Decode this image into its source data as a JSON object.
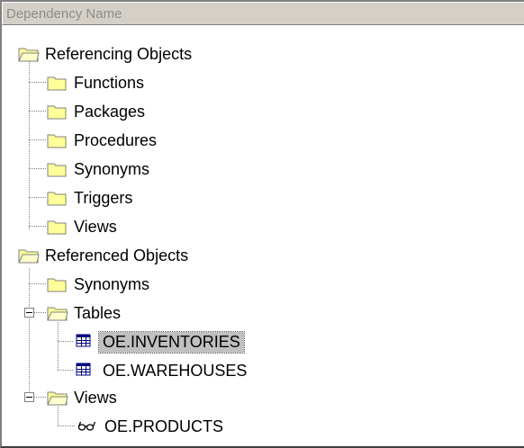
{
  "header": {
    "column_title": "Dependency Name"
  },
  "tree": {
    "referencing": {
      "label": "Referencing Objects",
      "children": [
        "Functions",
        "Packages",
        "Procedures",
        "Synonyms",
        "Triggers",
        "Views"
      ]
    },
    "referenced": {
      "label": "Referenced Objects",
      "synonyms": "Synonyms",
      "tables": {
        "label": "Tables",
        "children": [
          "OE.INVENTORIES",
          "OE.WAREHOUSES"
        ]
      },
      "views": {
        "label": "Views",
        "children": [
          "OE.PRODUCTS"
        ]
      }
    },
    "selected_item": "OE.INVENTORIES"
  },
  "icons": {
    "folder": "folder-icon",
    "folder_open": "folder-open-icon",
    "table": "table-icon",
    "view": "view-glasses-icon"
  },
  "colors": {
    "folder": "#ffff99",
    "selection": "#c0c0c0",
    "header_bg": "#d4d0c8"
  }
}
